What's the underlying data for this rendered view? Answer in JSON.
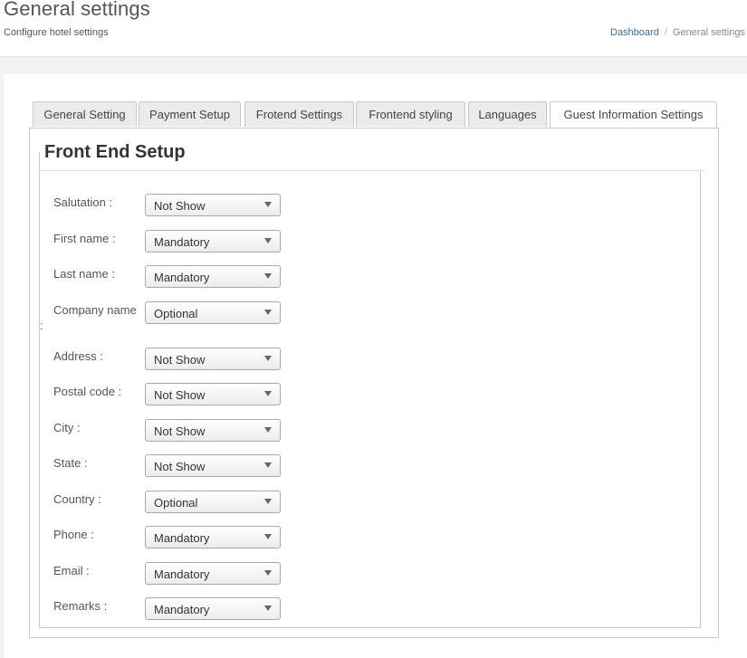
{
  "header": {
    "title": "General settings",
    "subtitle": "Configure hotel settings",
    "breadcrumb": {
      "link": "Dashboard",
      "separator": "/",
      "current": "General settings"
    }
  },
  "tabs": [
    {
      "label": "General Setting"
    },
    {
      "label": "Payment Setup"
    },
    {
      "label": "Frotend Settings"
    },
    {
      "label": "Frontend styling"
    },
    {
      "label": "Languages"
    },
    {
      "label": "Guest Information Settings",
      "active": true
    }
  ],
  "form": {
    "legend": "Front End Setup",
    "stray_colon": ":",
    "fields": [
      {
        "label": "Salutation :",
        "value": "Not Show"
      },
      {
        "label": "First name :",
        "value": "Mandatory"
      },
      {
        "label": "Last name :",
        "value": "Mandatory"
      },
      {
        "label": "Company name",
        "value": "Optional"
      },
      {
        "label": "Address :",
        "value": "Not Show"
      },
      {
        "label": "Postal code :",
        "value": "Not Show"
      },
      {
        "label": "City :",
        "value": "Not Show"
      },
      {
        "label": "State :",
        "value": "Not Show"
      },
      {
        "label": "Country :",
        "value": "Optional"
      },
      {
        "label": "Phone :",
        "value": "Mandatory"
      },
      {
        "label": "Email :",
        "value": "Mandatory"
      },
      {
        "label": "Remarks :",
        "value": "Mandatory"
      }
    ]
  },
  "icons": {
    "dropdown": "chevron-down-icon"
  }
}
